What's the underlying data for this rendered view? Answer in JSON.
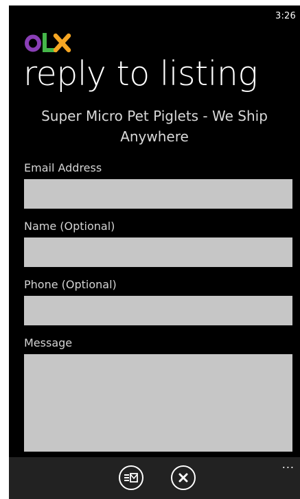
{
  "status_bar": {
    "time": "3:26"
  },
  "brand": {
    "logo_text": "OLX",
    "colors": {
      "o": "#8a3fb6",
      "l": "#45b649",
      "x": "#f6a623"
    }
  },
  "header": {
    "title": "reply to listing"
  },
  "listing": {
    "title": "Super Micro Pet Piglets - We Ship Anywhere"
  },
  "form": {
    "email_label": "Email Address",
    "email_value": "",
    "name_label": "Name (Optional)",
    "name_value": "",
    "phone_label": "Phone (Optional)",
    "phone_value": "",
    "message_label": "Message",
    "message_value": ""
  },
  "app_bar": {
    "send_icon": "send-message-icon",
    "cancel_icon": "close-icon",
    "more_label": "..."
  }
}
